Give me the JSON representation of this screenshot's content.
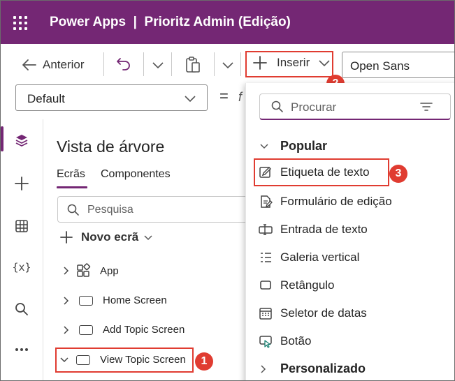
{
  "app": {
    "title": "Power Apps  |  Prioritz Admin (Edição)"
  },
  "toolbar": {
    "back_label": "Anterior",
    "insert_label": "Inserir",
    "font_value": "Open Sans",
    "property_value": "Default",
    "equals": "=",
    "formula_fragment": "f"
  },
  "tree": {
    "title": "Vista de árvore",
    "tabs": [
      "Ecrãs",
      "Componentes"
    ],
    "search_placeholder": "Pesquisa",
    "new_screen_label": "Novo ecrã",
    "items": [
      "App",
      "Home Screen",
      "Add Topic Screen",
      "View Topic Screen"
    ]
  },
  "insert_panel": {
    "search_placeholder": "Procurar",
    "section_popular": "Popular",
    "items": [
      "Etiqueta de texto",
      "Formulário de edição",
      "Entrada de texto",
      "Galeria vertical",
      "Retângulo",
      "Seletor de datas",
      "Botão"
    ],
    "section_custom": "Personalizado"
  },
  "annotations": [
    "1",
    "2",
    "3"
  ],
  "colors": {
    "brand": "#742774",
    "highlight": "#e03c31"
  }
}
